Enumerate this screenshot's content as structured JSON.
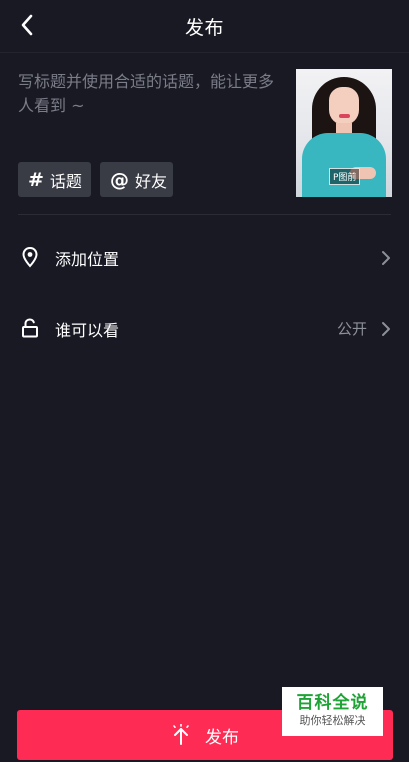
{
  "header": {
    "back_icon": "chevron-left-icon",
    "title": "发布"
  },
  "composer": {
    "caption_placeholder": "写标题并使用合适的话题，能让更多人看到 ~",
    "thumbnail_label": "P图前",
    "chips": [
      {
        "symbol": "#",
        "label": "话题",
        "icon": "hashtag-icon"
      },
      {
        "symbol": "@",
        "label": "好友",
        "icon": "at-icon"
      }
    ]
  },
  "options": {
    "location": {
      "label": "添加位置",
      "icon": "location-pin-icon"
    },
    "visibility": {
      "label": "谁可以看",
      "value": "公开",
      "icon": "unlock-icon"
    }
  },
  "publish": {
    "label": "发布",
    "icon": "publish-spark-icon"
  },
  "watermark": {
    "line1": "百科全说",
    "line2": "助你轻松解决"
  },
  "colors": {
    "background": "#181923",
    "accent": "#fe2c55",
    "chip_bg": "#393b45",
    "muted_text": "#7a7c87"
  }
}
